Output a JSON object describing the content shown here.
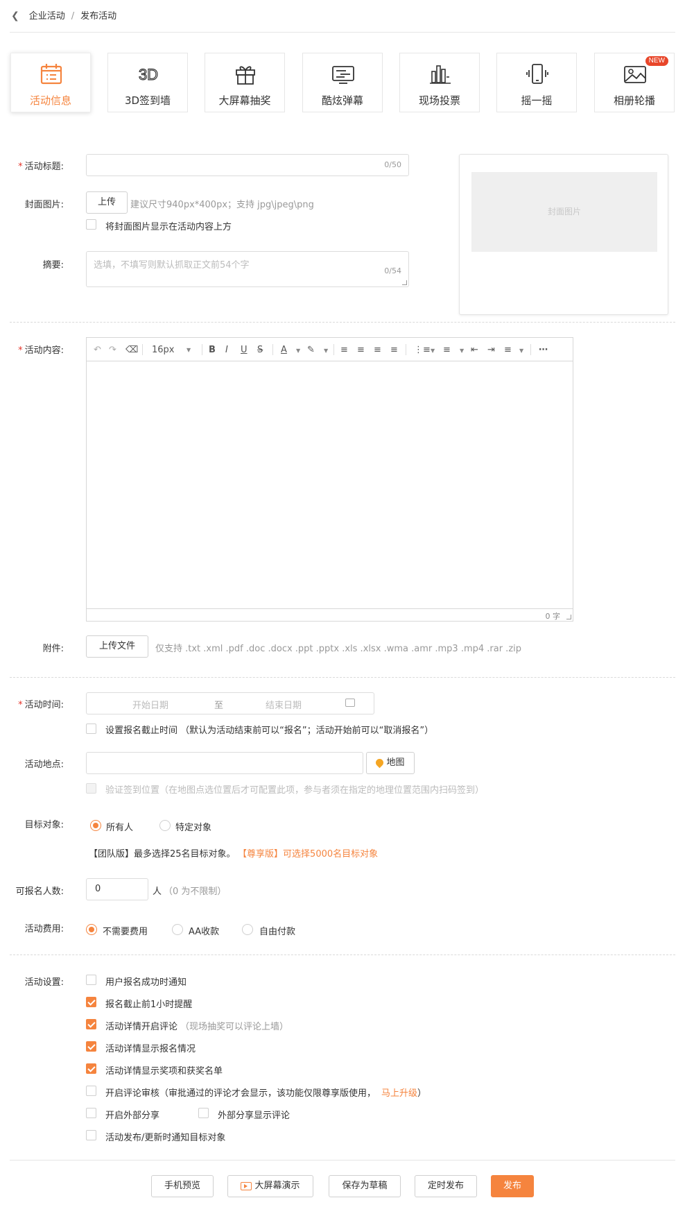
{
  "breadcrumb": {
    "parent": "企业活动",
    "separator": "/",
    "current": "发布活动"
  },
  "tabs": [
    {
      "label": "活动信息",
      "icon": "calendar-icon",
      "active": true
    },
    {
      "label": "3D签到墙",
      "icon": "3d-icon",
      "active": false
    },
    {
      "label": "大屏幕抽奖",
      "icon": "gift-icon",
      "active": false
    },
    {
      "label": "酷炫弹幕",
      "icon": "barrage-icon",
      "active": false
    },
    {
      "label": "现场投票",
      "icon": "bar-chart-icon",
      "active": false
    },
    {
      "label": "摇一摇",
      "icon": "phone-shake-icon",
      "active": false
    },
    {
      "label": "相册轮播",
      "icon": "image-icon",
      "active": false,
      "badge": "NEW"
    }
  ],
  "form": {
    "title": {
      "label": "活动标题:",
      "value": "",
      "counter": "0/50"
    },
    "cover": {
      "label": "封面图片:",
      "upload_label": "上传",
      "hint": "建议尺寸940px*400px；支持 jpg\\jpeg\\png",
      "show_above_label": "将封面图片显示在活动内容上方",
      "preview_label": "封面图片"
    },
    "summary": {
      "label": "摘要:",
      "placeholder": "选填，不填写则默认抓取正文前54个字",
      "counter": "0/54"
    },
    "content": {
      "label": "活动内容:",
      "font_size": "16px",
      "word_count": "0 字"
    },
    "attachment": {
      "label": "附件:",
      "upload_label": "上传文件",
      "hint": "仅支持 .txt .xml .pdf .doc .docx .ppt .pptx .xls .xlsx .wma .amr .mp3 .mp4 .rar .zip"
    },
    "time": {
      "label": "活动时间:",
      "start_placeholder": "开始日期",
      "separator": "至",
      "end_placeholder": "结束日期",
      "deadline_label": "设置报名截止时间 （默认为活动结束前可以“报名”；活动开始前可以“取消报名”）"
    },
    "location": {
      "label": "活动地点:",
      "value": "",
      "map_label": "地图",
      "verify_label": "验证签到位置（在地图点选位置后才可配置此项，参与者须在指定的地理位置范围内扫码签到）"
    },
    "target": {
      "label": "目标对象:",
      "options": [
        "所有人",
        "特定对象"
      ],
      "selected": "所有人",
      "note_team": "【团队版】最多选择25名目标对象。",
      "note_premium": "【尊享版】可选择5000名目标对象"
    },
    "capacity": {
      "label": "可报名人数:",
      "value": "0",
      "unit": "人",
      "note": "（0 为不限制）"
    },
    "fee": {
      "label": "活动费用:",
      "options": [
        "不需要费用",
        "AA收款",
        "自由付款"
      ],
      "selected": "不需要费用"
    },
    "settings": {
      "label": "活动设置:",
      "items": [
        {
          "label": "用户报名成功时通知",
          "checked": false
        },
        {
          "label": "报名截止前1小时提醒",
          "checked": true
        },
        {
          "label": "活动详情开启评论",
          "note": "（现场抽奖可以评论上墙）",
          "checked": true
        },
        {
          "label": "活动详情显示报名情况",
          "checked": true
        },
        {
          "label": "活动详情显示奖项和获奖名单",
          "checked": true
        },
        {
          "label": "开启评论审核（审批通过的评论才会显示，该功能仅限尊享版使用，",
          "link": "马上升级",
          "tail": "）",
          "checked": false
        },
        {
          "label": "开启外部分享",
          "checked": false
        },
        {
          "label": "外部分享显示评论",
          "checked": false
        },
        {
          "label": "活动发布/更新时通知目标对象",
          "checked": false
        }
      ]
    }
  },
  "footer": {
    "preview": "手机预览",
    "big_screen": "大屏幕演示",
    "save_draft": "保存为草稿",
    "schedule": "定时发布",
    "publish": "发布"
  },
  "colors": {
    "accent": "#f5843e",
    "required": "#e5352b",
    "border": "#dcdcdc",
    "badge": "#e8462a"
  }
}
